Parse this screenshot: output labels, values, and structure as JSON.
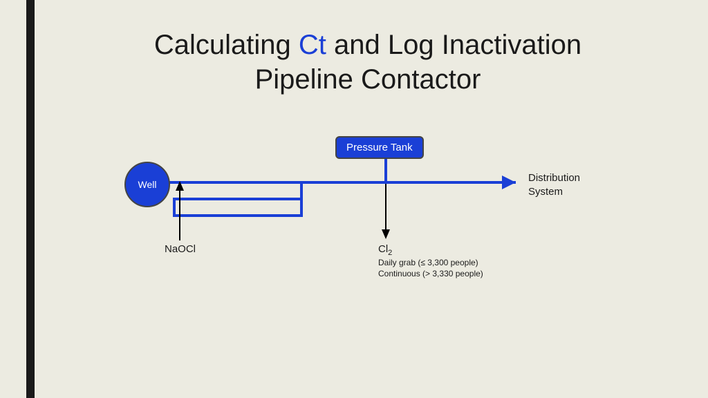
{
  "title": {
    "prefix": "Calculating ",
    "ct": "Ct",
    "suffix": " and Log Inactivation",
    "line2": "Pipeline Contactor"
  },
  "diagram": {
    "well_label": "Well",
    "pressure_tank_label": "Pressure Tank",
    "naocl_label": "NaOCl",
    "cl2_label_base": "Cl",
    "cl2_label_sub": "2",
    "cl2_detail_line1": "Daily grab (≤ 3,300 people)",
    "cl2_detail_line2": "Continuous (> 3,330 people)",
    "distribution_line1": "Distribution",
    "distribution_line2": "System"
  },
  "colors": {
    "pipe": "#1a3fd6",
    "accent": "#1a3fd6",
    "text": "#1a1a1a"
  }
}
